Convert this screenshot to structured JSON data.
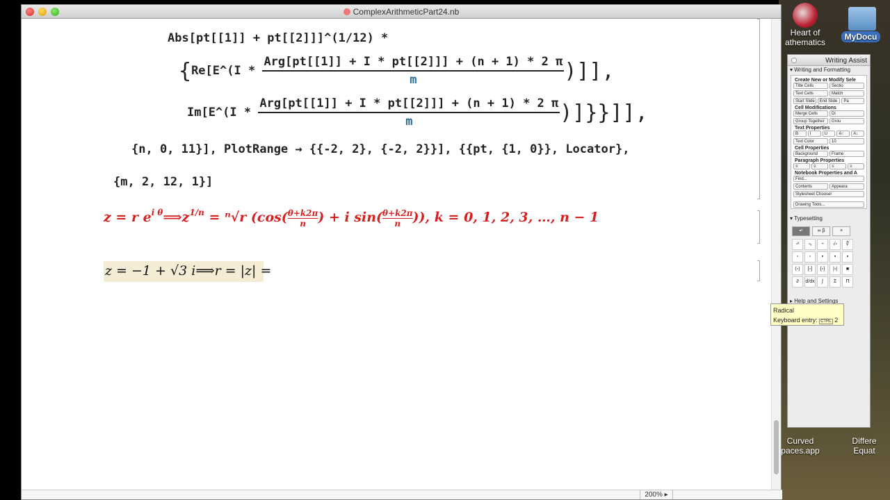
{
  "window": {
    "title": "ComplexArithmeticPart24.nb"
  },
  "desktop": {
    "heart_label": "Heart of",
    "heart_label2": "athematics",
    "mydocs_label": "MyDocu",
    "curved_label": "Curved",
    "curved_label2": "paces.app",
    "diffeq_label": "Differe",
    "diffeq_label2": "Equat"
  },
  "code": {
    "line0": "Abs[pt[[1]] + pt[[2]]]^(1/12) *",
    "re_prefix": "Re[E^(I *",
    "arg_num": "Arg[pt[[1]] + I * pt[[2]]] + (n + 1) * 2 π",
    "den": "m",
    "im_prefix": "Im[E^(I *",
    "plot_line": "{n, 0, 11}], PlotRange → {{-2, 2}, {-2, 2}}], {{pt, {1, 0}}, Locator},",
    "m_line": "{m, 2, 12, 1}]"
  },
  "formula": {
    "lhs": "z = r e",
    "exp": "i θ",
    "arrow": "⟹z",
    "root_exp": "1/n",
    "eq": " = ",
    "root": "ⁿ√r",
    "cos": " (cos(",
    "frac_num": "θ+k2π",
    "frac_den": "n",
    "mid": ") + i sin(",
    "tail": ")), k = 0, 1, 2, 3, …, n − 1"
  },
  "input_cell": {
    "text": "z = −1 + √3  i⟹r = |z| ="
  },
  "status": {
    "zoom": "200%"
  },
  "palette": {
    "title": "Writing Assist",
    "writing_formatting": "Writing and Formatting",
    "create_new": "Create New or Modify Sele",
    "title_cells": "Title Cells",
    "section": "Sectio",
    "text_cells": "Text Cells",
    "match": "Match",
    "start_slide": "Start Slide",
    "end_slide": "End Slide",
    "pa": "Pa",
    "cell_mods": "Cell Modifications",
    "merge_cells": "Merge Cells",
    "di": "Di",
    "group_together": "Group Together",
    "grou": "Grou",
    "text_props": "Text Properties",
    "text_color": "Text Color",
    "size": "10",
    "cell_props": "Cell Properties",
    "background": "Background",
    "frame": "Frame",
    "para_props": "Paragraph Properties",
    "notebook_props": "Notebook Properties and A",
    "find": "Find...",
    "contents": "Contents",
    "appear": "Appeara",
    "stylesheet": "Stylesheet Chooser",
    "drawing": "Drawing Tools...",
    "typesetting": "Typesetting",
    "help": "Help and Settings"
  },
  "tooltip": {
    "title": "Radical",
    "entry": "Keyboard entry:",
    "key": "CTRL",
    "num": "2"
  }
}
